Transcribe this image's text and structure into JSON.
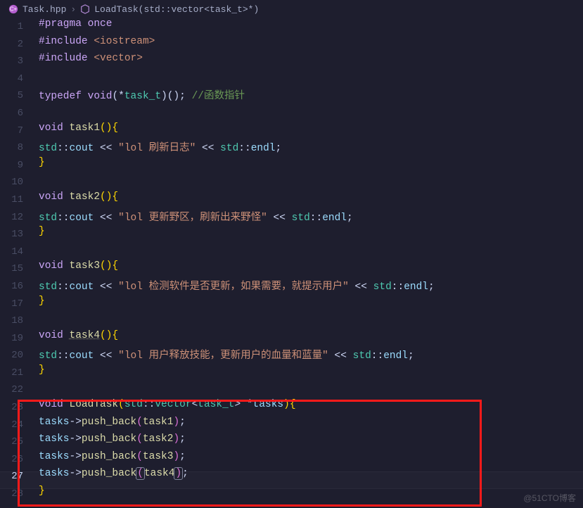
{
  "breadcrumb": {
    "file": "Task.hpp",
    "symbol": "LoadTask(std::vector<task_t>*)"
  },
  "code": {
    "lines": [
      {
        "n": 1,
        "tokens": [
          {
            "t": "#pragma",
            "c": "kw"
          },
          {
            "t": " "
          },
          {
            "t": "once",
            "c": "kw"
          }
        ]
      },
      {
        "n": 2,
        "tokens": [
          {
            "t": "#include",
            "c": "kw"
          },
          {
            "t": " "
          },
          {
            "t": "<iostream>",
            "c": "str"
          }
        ]
      },
      {
        "n": 3,
        "tokens": [
          {
            "t": "#include",
            "c": "kw"
          },
          {
            "t": " "
          },
          {
            "t": "<vector>",
            "c": "str"
          }
        ]
      },
      {
        "n": 4,
        "tokens": []
      },
      {
        "n": 5,
        "tokens": [
          {
            "t": "typedef",
            "c": "kw"
          },
          {
            "t": " "
          },
          {
            "t": "void",
            "c": "kw"
          },
          {
            "t": "("
          },
          {
            "t": "*"
          },
          {
            "t": "task_t",
            "c": "typ"
          },
          {
            "t": ")();"
          },
          {
            "t": " "
          },
          {
            "t": "//函数指针",
            "c": "cmt"
          }
        ]
      },
      {
        "n": 6,
        "tokens": []
      },
      {
        "n": 7,
        "tokens": [
          {
            "t": "void",
            "c": "kw"
          },
          {
            "t": " "
          },
          {
            "t": "task1",
            "c": "fn"
          },
          {
            "t": "(){",
            "c": "br"
          }
        ]
      },
      {
        "n": 8,
        "tokens": [
          {
            "t": "    "
          },
          {
            "t": "std",
            "c": "ns"
          },
          {
            "t": "::"
          },
          {
            "t": "cout",
            "c": "var"
          },
          {
            "t": " << "
          },
          {
            "t": "\"lol 刷新日志\"",
            "c": "str"
          },
          {
            "t": " << "
          },
          {
            "t": "std",
            "c": "ns"
          },
          {
            "t": "::"
          },
          {
            "t": "endl",
            "c": "var"
          },
          {
            "t": ";"
          }
        ]
      },
      {
        "n": 9,
        "tokens": [
          {
            "t": "}",
            "c": "br"
          }
        ]
      },
      {
        "n": 10,
        "tokens": []
      },
      {
        "n": 11,
        "tokens": [
          {
            "t": "void",
            "c": "kw"
          },
          {
            "t": " "
          },
          {
            "t": "task2",
            "c": "fn"
          },
          {
            "t": "(){",
            "c": "br"
          }
        ]
      },
      {
        "n": 12,
        "tokens": [
          {
            "t": "    "
          },
          {
            "t": "std",
            "c": "ns"
          },
          {
            "t": "::"
          },
          {
            "t": "cout",
            "c": "var"
          },
          {
            "t": " << "
          },
          {
            "t": "\"lol 更新野区，刷新出来野怪\"",
            "c": "str"
          },
          {
            "t": " << "
          },
          {
            "t": "std",
            "c": "ns"
          },
          {
            "t": "::"
          },
          {
            "t": "endl",
            "c": "var"
          },
          {
            "t": ";"
          }
        ]
      },
      {
        "n": 13,
        "tokens": [
          {
            "t": "}",
            "c": "br"
          }
        ]
      },
      {
        "n": 14,
        "tokens": []
      },
      {
        "n": 15,
        "tokens": [
          {
            "t": "void",
            "c": "kw"
          },
          {
            "t": " "
          },
          {
            "t": "task3",
            "c": "fn"
          },
          {
            "t": "(){",
            "c": "br"
          }
        ]
      },
      {
        "n": 16,
        "tokens": [
          {
            "t": "    "
          },
          {
            "t": "std",
            "c": "ns"
          },
          {
            "t": "::"
          },
          {
            "t": "cout",
            "c": "var"
          },
          {
            "t": " << "
          },
          {
            "t": "\"lol 检测软件是否更新，如果需要，就提示用户\"",
            "c": "str"
          },
          {
            "t": " << "
          },
          {
            "t": "std",
            "c": "ns"
          },
          {
            "t": "::"
          },
          {
            "t": "endl",
            "c": "var"
          },
          {
            "t": ";"
          }
        ]
      },
      {
        "n": 17,
        "tokens": [
          {
            "t": "}",
            "c": "br"
          }
        ]
      },
      {
        "n": 18,
        "tokens": []
      },
      {
        "n": 19,
        "tokens": [
          {
            "t": "void",
            "c": "kw"
          },
          {
            "t": " "
          },
          {
            "t": "task4",
            "c": "fn-title"
          },
          {
            "t": "(){",
            "c": "br"
          }
        ]
      },
      {
        "n": 20,
        "tokens": [
          {
            "t": "    "
          },
          {
            "t": "std",
            "c": "ns"
          },
          {
            "t": "::"
          },
          {
            "t": "cout",
            "c": "var"
          },
          {
            "t": " << "
          },
          {
            "t": "\"lol 用户释放技能，更新用户的血量和蓝量\"",
            "c": "str"
          },
          {
            "t": " << "
          },
          {
            "t": "std",
            "c": "ns"
          },
          {
            "t": "::"
          },
          {
            "t": "endl",
            "c": "var"
          },
          {
            "t": ";"
          }
        ]
      },
      {
        "n": 21,
        "tokens": [
          {
            "t": "}",
            "c": "br"
          }
        ]
      },
      {
        "n": 22,
        "tokens": []
      },
      {
        "n": 23,
        "tokens": [
          {
            "t": "void",
            "c": "kw"
          },
          {
            "t": " "
          },
          {
            "t": "LoadTask",
            "c": "fn"
          },
          {
            "t": "(",
            "c": "br"
          },
          {
            "t": "std",
            "c": "ns"
          },
          {
            "t": "::"
          },
          {
            "t": "vector",
            "c": "typ"
          },
          {
            "t": "<"
          },
          {
            "t": "task_t",
            "c": "typ"
          },
          {
            "t": "> *"
          },
          {
            "t": "tasks",
            "c": "ptr"
          },
          {
            "t": ")",
            "c": "br"
          },
          {
            "t": "{",
            "c": "br"
          }
        ]
      },
      {
        "n": 24,
        "tokens": [
          {
            "t": "    "
          },
          {
            "t": "tasks",
            "c": "ptr"
          },
          {
            "t": "->"
          },
          {
            "t": "push_back",
            "c": "fn"
          },
          {
            "t": "(",
            "c": "br2"
          },
          {
            "t": "task1",
            "c": "fn"
          },
          {
            "t": ")",
            "c": "br2"
          },
          {
            "t": ";"
          }
        ]
      },
      {
        "n": 25,
        "tokens": [
          {
            "t": "    "
          },
          {
            "t": "tasks",
            "c": "ptr"
          },
          {
            "t": "->"
          },
          {
            "t": "push_back",
            "c": "fn"
          },
          {
            "t": "(",
            "c": "br2"
          },
          {
            "t": "task2",
            "c": "fn"
          },
          {
            "t": ")",
            "c": "br2"
          },
          {
            "t": ";"
          }
        ]
      },
      {
        "n": 26,
        "tokens": [
          {
            "t": "    "
          },
          {
            "t": "tasks",
            "c": "ptr"
          },
          {
            "t": "->"
          },
          {
            "t": "push_back",
            "c": "fn"
          },
          {
            "t": "(",
            "c": "br2"
          },
          {
            "t": "task3",
            "c": "fn"
          },
          {
            "t": ")",
            "c": "br2"
          },
          {
            "t": ";"
          }
        ]
      },
      {
        "n": 27,
        "current": true,
        "tokens": [
          {
            "t": "    "
          },
          {
            "t": "tasks",
            "c": "ptr"
          },
          {
            "t": "->"
          },
          {
            "t": "push_back",
            "c": "fn"
          },
          {
            "t": "(",
            "c": "br2",
            "box": true
          },
          {
            "t": "task4",
            "c": "fn"
          },
          {
            "t": ")",
            "c": "br2",
            "box": true
          },
          {
            "t": ";"
          }
        ]
      },
      {
        "n": 28,
        "tokens": [
          {
            "t": "}",
            "c": "br"
          }
        ]
      }
    ]
  },
  "watermark": "@51CTO博客"
}
